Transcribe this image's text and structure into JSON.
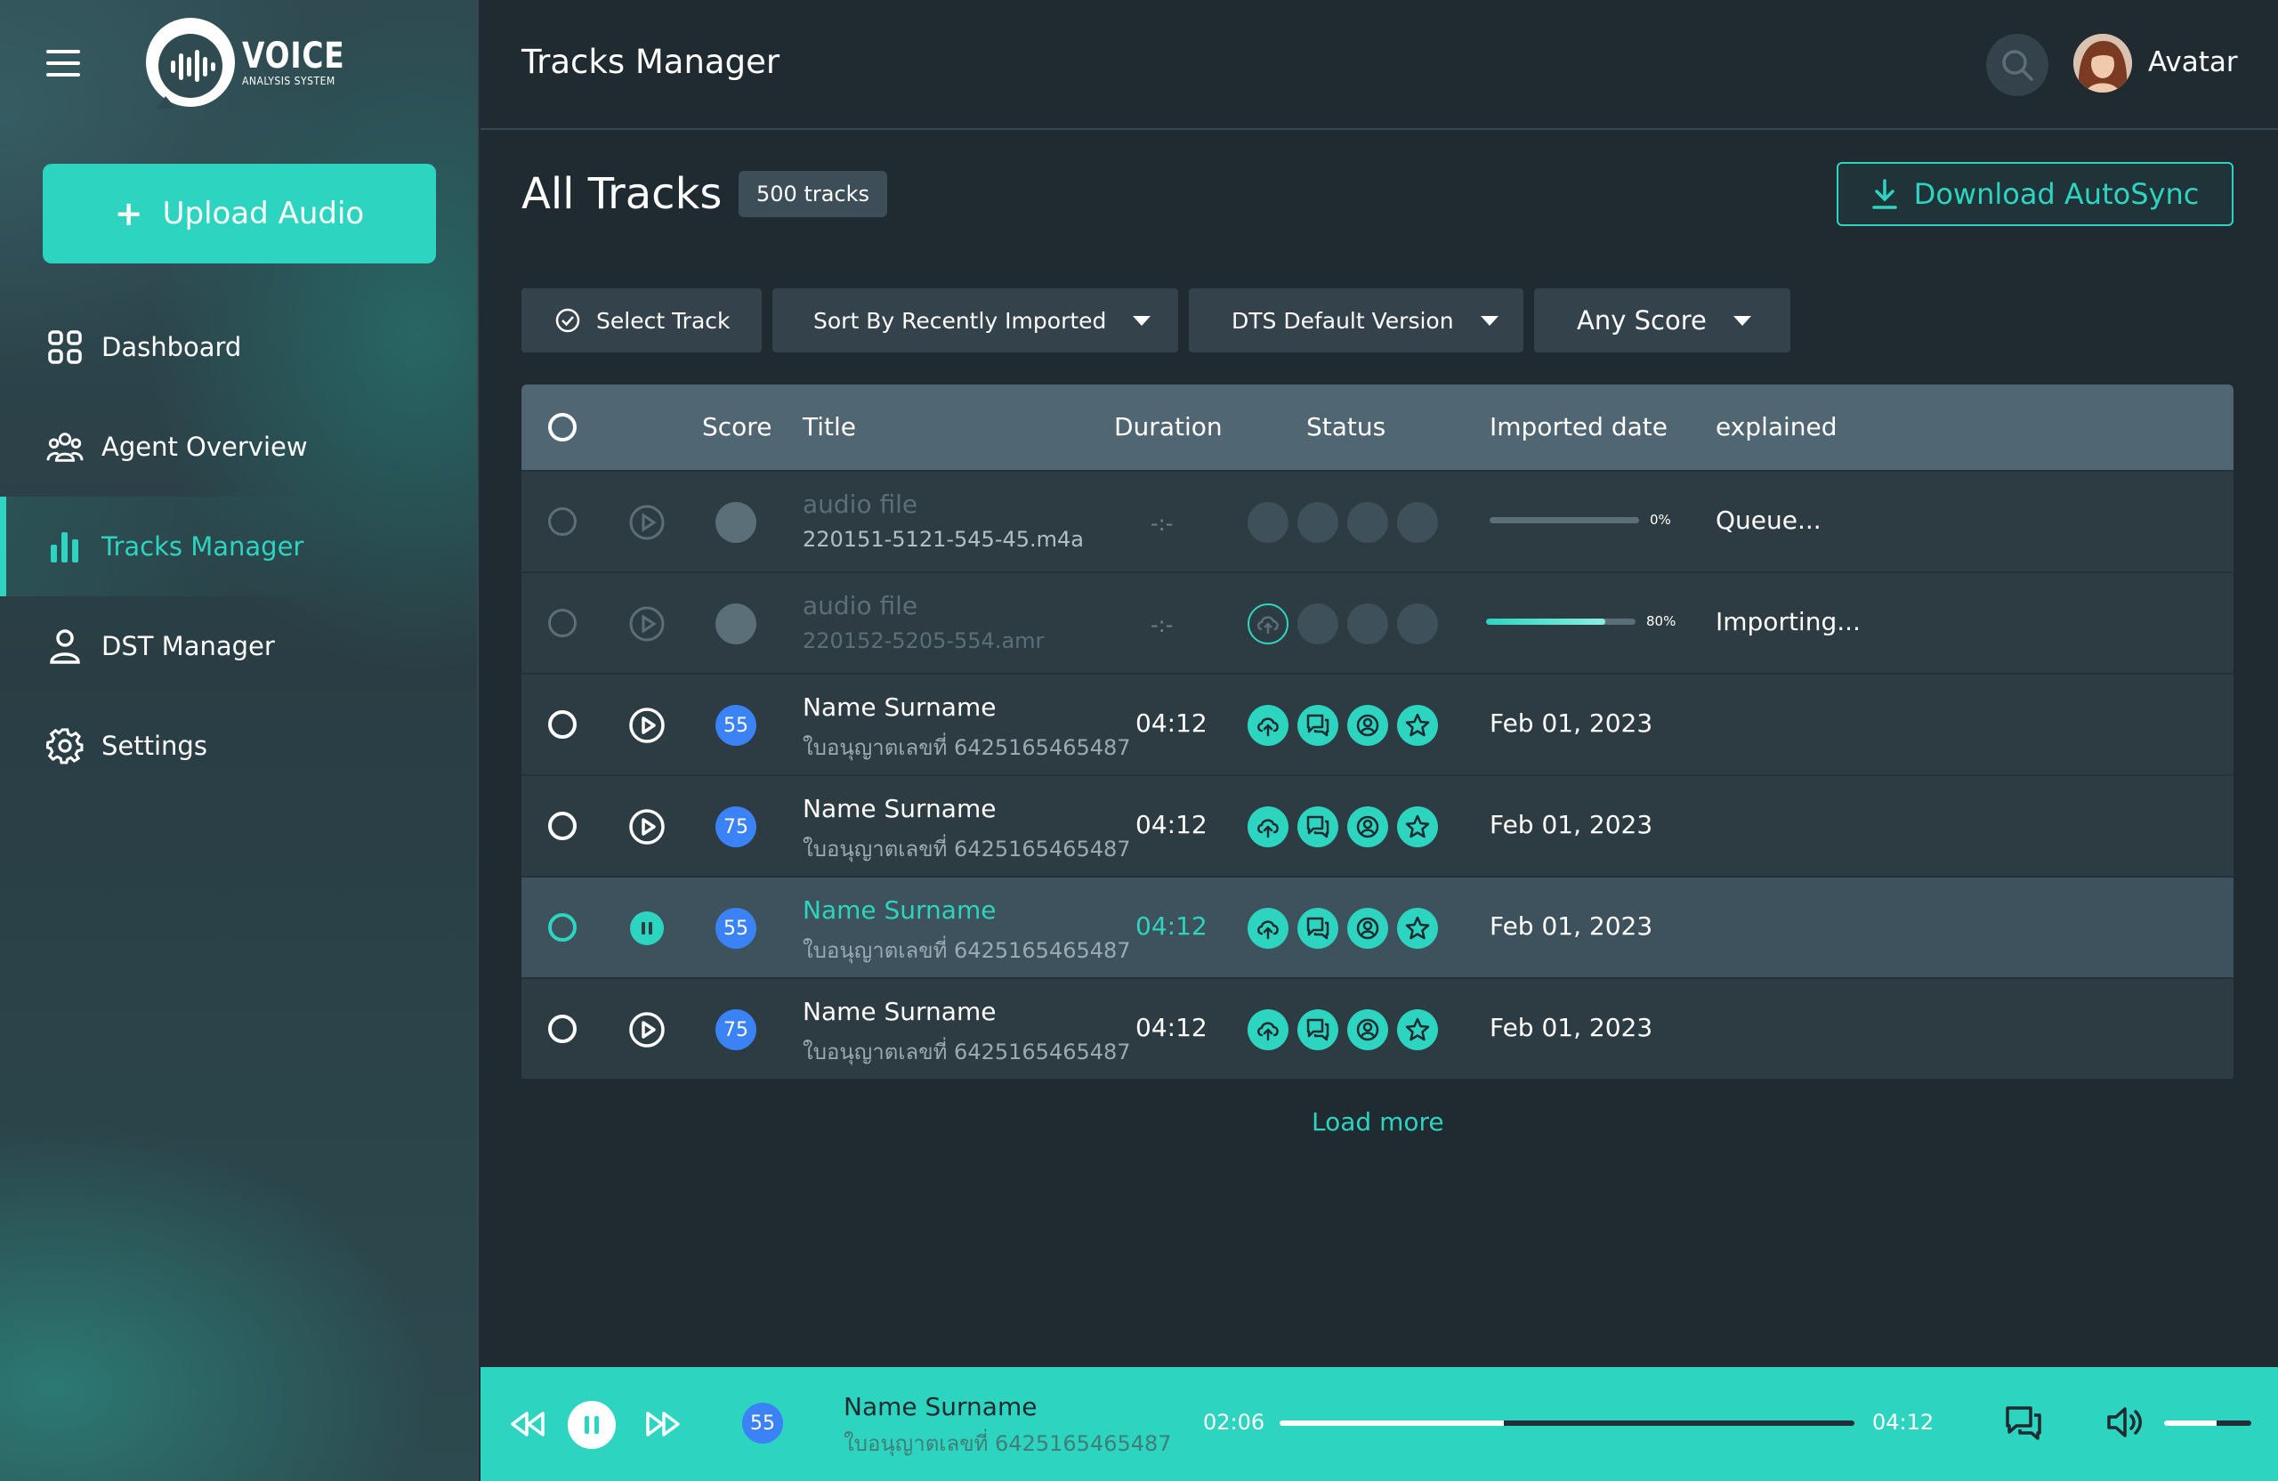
{
  "logo": {
    "title": "VOICE",
    "subtitle": "ANALYSIS SYSTEM"
  },
  "sidebar": {
    "upload_label": "Upload Audio",
    "items": [
      {
        "label": "Dashboard",
        "icon": "grid-icon"
      },
      {
        "label": "Agent Overview",
        "icon": "users-icon"
      },
      {
        "label": "Tracks Manager",
        "icon": "bar-chart-icon",
        "active": true
      },
      {
        "label": "DST Manager",
        "icon": "user-icon"
      },
      {
        "label": "Settings",
        "icon": "gear-icon"
      }
    ]
  },
  "header": {
    "title": "Tracks Manager",
    "avatar_name": "Avatar"
  },
  "main": {
    "title": "All Tracks",
    "count_badge": "500 tracks",
    "download_label": "Download AutoSync",
    "filters": {
      "select": "Select Track",
      "sort": "Sort By Recently Imported",
      "version": "DTS Default Version",
      "score": "Any Score"
    },
    "columns": {
      "score": "Score",
      "title": "Title",
      "duration": "Duration",
      "status": "Status",
      "imported": "Imported date",
      "explained": "explained"
    },
    "rows": [
      {
        "score": "",
        "title": "audio file",
        "subtitle": "220151-5121-545-45.m4a",
        "duration": "-:-",
        "progress": 0,
        "progress_label": "0%",
        "explained": "Queue..."
      },
      {
        "score": "",
        "title": "audio file",
        "subtitle": "220152-5205-554.amr",
        "duration": "-:-",
        "progress": 80,
        "progress_label": "80%",
        "explained": "Importing..."
      },
      {
        "score": "55",
        "title": "Name Surname",
        "subtitle": "ใบอนุญาตเลขที่ 6425165465487",
        "duration": "04:12",
        "date": "Feb 01, 2023"
      },
      {
        "score": "75",
        "title": "Name Surname",
        "subtitle": "ใบอนุญาตเลขที่ 6425165465487",
        "duration": "04:12",
        "date": "Feb 01, 2023"
      },
      {
        "score": "55",
        "title": "Name Surname",
        "subtitle": "ใบอนุญาตเลขที่ 6425165465487",
        "duration": "04:12",
        "date": "Feb 01, 2023",
        "playing": true
      },
      {
        "score": "75",
        "title": "Name Surname",
        "subtitle": "ใบอนุญาตเลขที่ 6425165465487",
        "duration": "04:12",
        "date": "Feb 01, 2023"
      }
    ],
    "load_more": "Load more"
  },
  "player": {
    "score": "55",
    "name": "Name Surname",
    "subtitle": "ใบอนุญาตเลขที่ 6425165465487",
    "current_time": "02:06",
    "total_time": "04:12",
    "progress": 0.39,
    "volume": 0.6
  },
  "colors": {
    "accent": "#2dd4bf",
    "score_blue": "#3b82f6",
    "bg": "#1f2a31"
  }
}
